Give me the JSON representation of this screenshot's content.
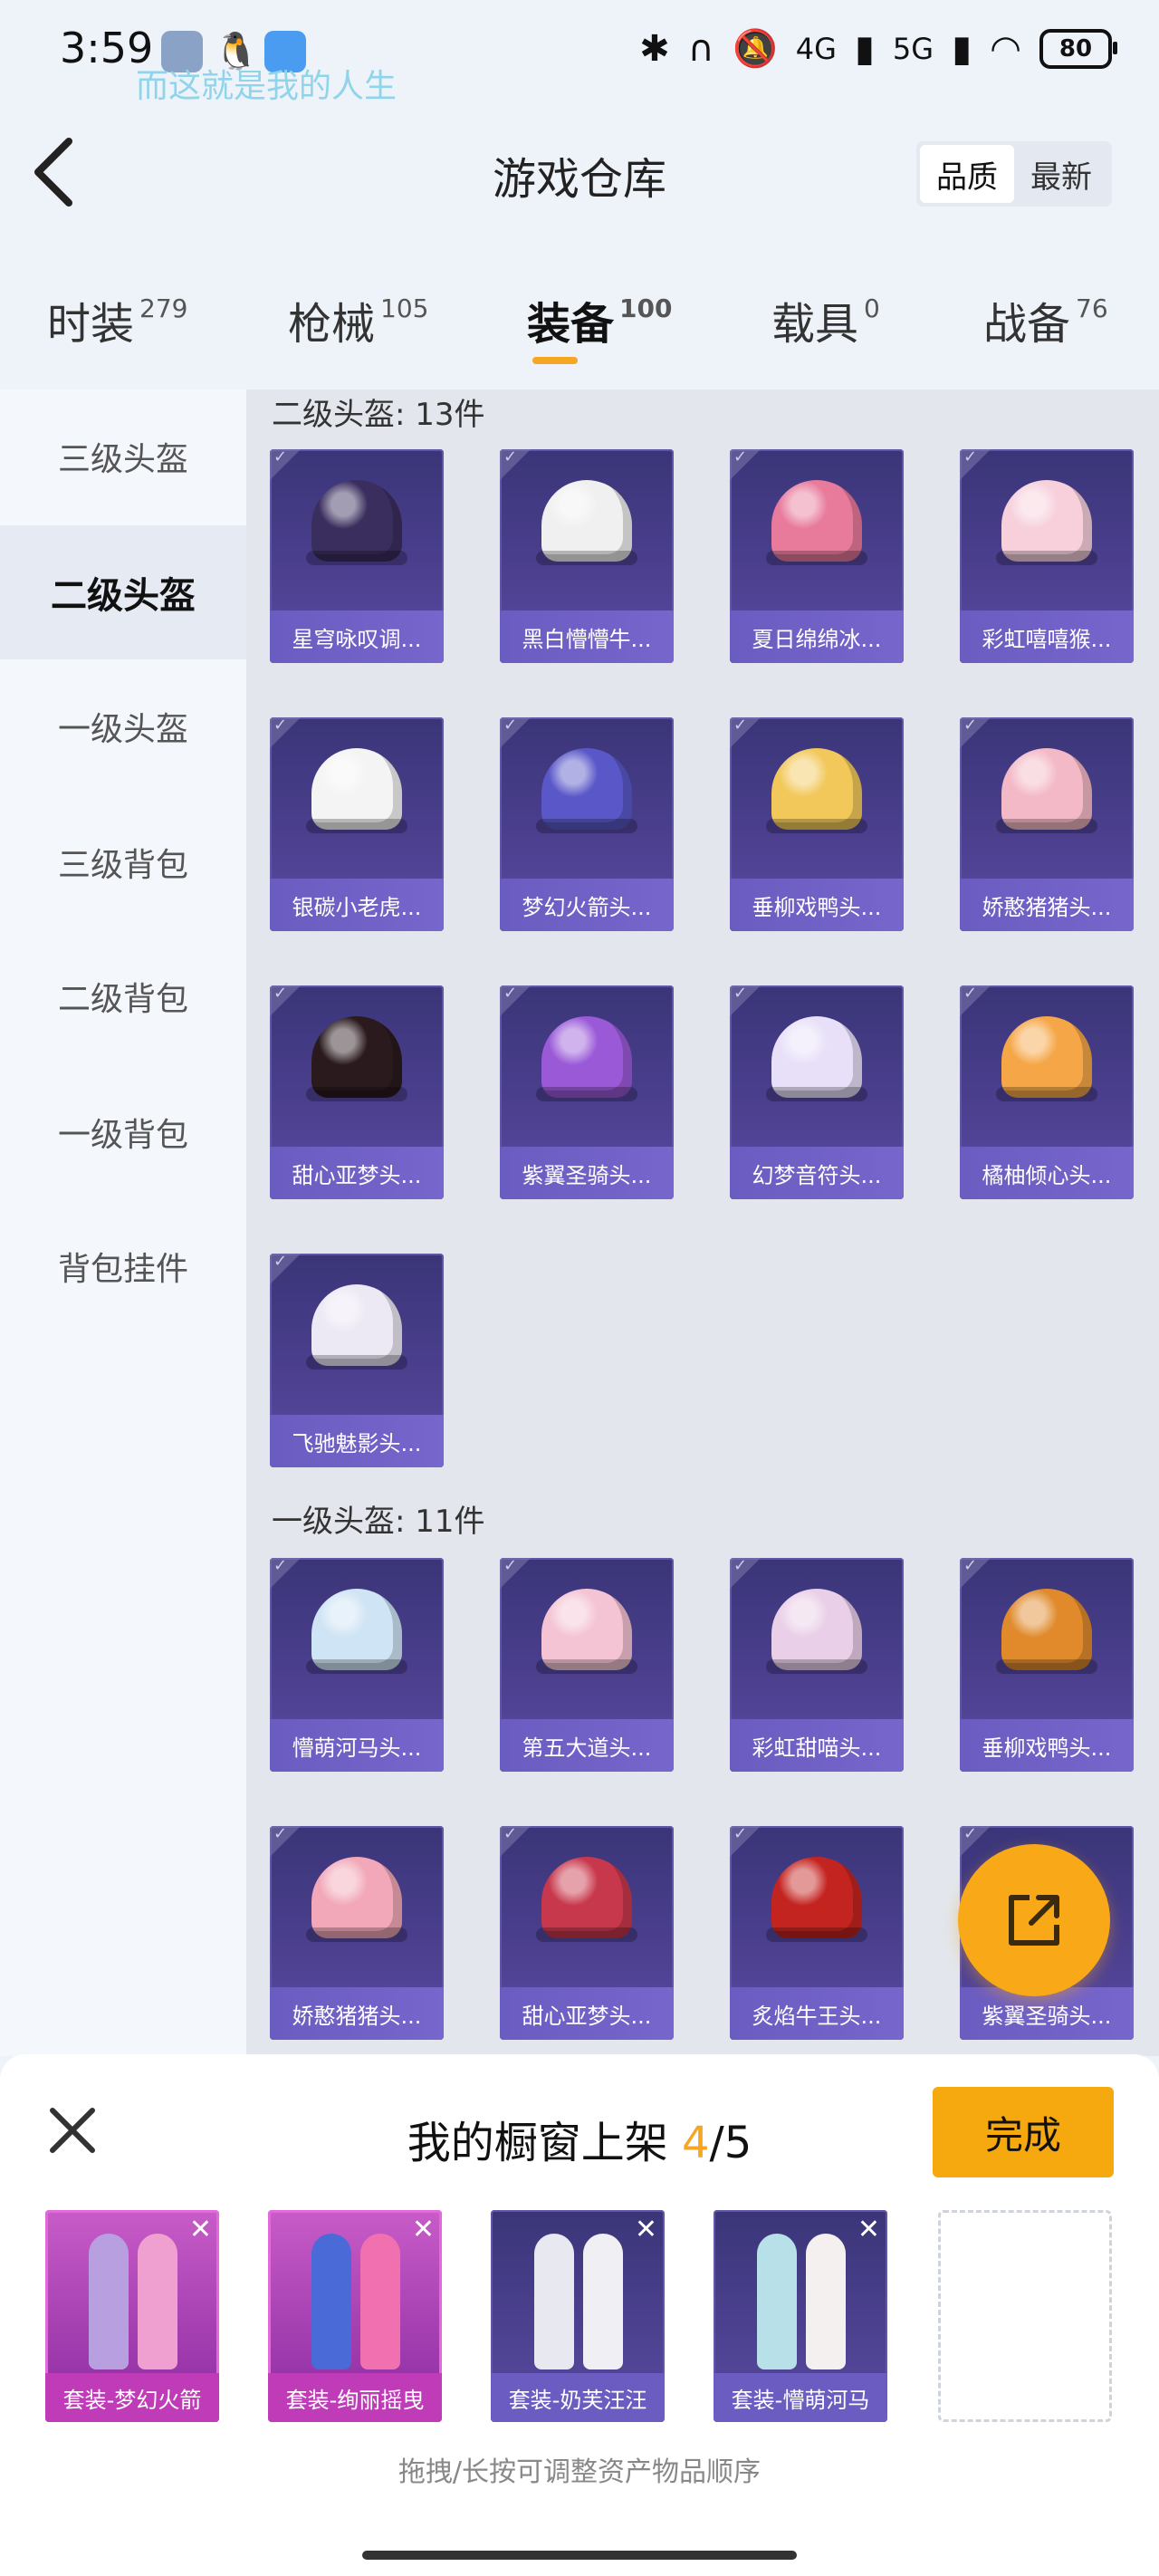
{
  "status": {
    "time": "3:59",
    "lyric": "而这就是我的人生",
    "network1": "4G",
    "network2": "5G",
    "battery": "80"
  },
  "header": {
    "title": "游戏仓库",
    "sort": [
      "品质",
      "最新"
    ]
  },
  "tabs": [
    {
      "label": "时装",
      "count": "279"
    },
    {
      "label": "枪械",
      "count": "105"
    },
    {
      "label": "装备",
      "count": "100"
    },
    {
      "label": "载具",
      "count": "0"
    },
    {
      "label": "战备",
      "count": "76"
    }
  ],
  "sidebar": [
    "三级头盔",
    "二级头盔",
    "一级头盔",
    "三级背包",
    "二级背包",
    "一级背包",
    "背包挂件"
  ],
  "sections": [
    {
      "title": "二级头盔: 13件",
      "items": [
        {
          "name": "星穹咏叹调...",
          "color": "#3a2e5e"
        },
        {
          "name": "黑白懵懵牛...",
          "color": "#f0f0f0"
        },
        {
          "name": "夏日绵绵冰...",
          "color": "#e87a9c"
        },
        {
          "name": "彩虹嘻嘻猴...",
          "color": "#f7d0dc"
        },
        {
          "name": "银碳小老虎...",
          "color": "#f4f4f4"
        },
        {
          "name": "梦幻火箭头...",
          "color": "#5a58c8"
        },
        {
          "name": "垂柳戏鸭头...",
          "color": "#f2c85a"
        },
        {
          "name": "娇憨猪猪头...",
          "color": "#f3b9c6"
        },
        {
          "name": "甜心亚梦头...",
          "color": "#2a1a1e"
        },
        {
          "name": "紫翼圣骑头...",
          "color": "#9a5ad8"
        },
        {
          "name": "幻梦音符头...",
          "color": "#e8e0f8"
        },
        {
          "name": "橘柚倾心头...",
          "color": "#f5a646"
        },
        {
          "name": "飞驰魅影头...",
          "color": "#ece8f4"
        }
      ]
    },
    {
      "title": "一级头盔: 11件",
      "items": [
        {
          "name": "懵萌河马头...",
          "color": "#cfe4f4"
        },
        {
          "name": "第五大道头...",
          "color": "#f4c4d4"
        },
        {
          "name": "彩虹甜喵头...",
          "color": "#eacfe8"
        },
        {
          "name": "垂柳戏鸭头...",
          "color": "#e08a2c"
        },
        {
          "name": "娇憨猪猪头...",
          "color": "#f2a8b8"
        },
        {
          "name": "甜心亚梦头...",
          "color": "#c8384c"
        },
        {
          "name": "炙焰牛王头...",
          "color": "#c42420"
        },
        {
          "name": "紫翼圣骑头...",
          "color": "#8a5ad0"
        }
      ]
    }
  ],
  "sheet": {
    "title_prefix": "我的橱窗上架 ",
    "current": "4",
    "total": "/5",
    "done": "完成",
    "slots": [
      {
        "label": "套装-梦幻火箭",
        "style": "pink",
        "colors": [
          "#b8a0e0",
          "#f0a0d0"
        ]
      },
      {
        "label": "套装-绚丽摇曳",
        "style": "pink",
        "colors": [
          "#4a6ad8",
          "#f070b0"
        ]
      },
      {
        "label": "套装-奶芙汪汪",
        "style": "dark",
        "colors": [
          "#e8e8f0",
          "#f0f0f4"
        ]
      },
      {
        "label": "套装-懵萌河马",
        "style": "dark",
        "colors": [
          "#b8e0e8",
          "#f4f0f0"
        ]
      }
    ],
    "hint": "拖拽/长按可调整资产物品顺序"
  }
}
